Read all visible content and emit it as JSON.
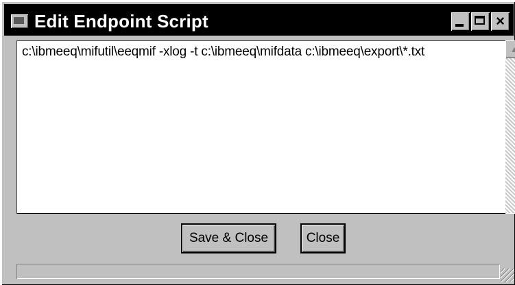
{
  "window": {
    "title": "Edit Endpoint Script",
    "app_icon": "app-icon"
  },
  "titlebar_buttons": {
    "minimize_icon": "minimize-icon",
    "maximize_icon": "maximize-icon",
    "close_glyph": "×"
  },
  "editor": {
    "content": "c:\\ibmeeq\\mifutil\\eeqmif -xlog -t c:\\ibmeeq\\mifdata c:\\ibmeeq\\export\\*.txt"
  },
  "scrollbars": {
    "up_arrow": "▲",
    "down_arrow": "▼",
    "left_arrow": "◀",
    "right_arrow": "▶"
  },
  "buttons": {
    "save_close_label": "Save & Close",
    "close_label": "Close"
  },
  "status": {
    "text": ""
  },
  "colors": {
    "titlebar": "#000000",
    "face": "#c0c0c0",
    "editor_bg": "#ffffff"
  }
}
